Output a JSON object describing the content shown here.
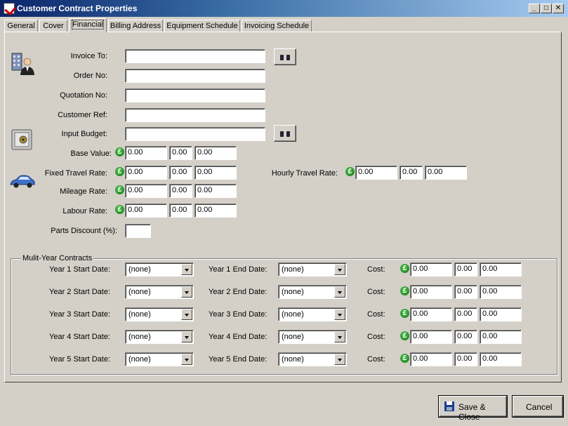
{
  "window": {
    "title": "Customer Contract Properties",
    "minimize": "_",
    "maximize": "□",
    "close": "✕"
  },
  "tabs": [
    {
      "label": "General"
    },
    {
      "label": "Cover"
    },
    {
      "label": "Financial"
    },
    {
      "label": "Billing Address"
    },
    {
      "label": "Equipment Schedule"
    },
    {
      "label": "Invoicing Schedule"
    }
  ],
  "active_tab": "Financial",
  "currency_symbol": "£",
  "fields": {
    "invoice_to": {
      "label": "Invoice To:",
      "value": ""
    },
    "order_no": {
      "label": "Order No:",
      "value": ""
    },
    "quotation_no": {
      "label": "Quotation No:",
      "value": ""
    },
    "customer_ref": {
      "label": "Customer Ref:",
      "value": ""
    },
    "input_budget": {
      "label": "Input Budget:",
      "value": ""
    },
    "parts_discount": {
      "label": "Parts Discount (%):",
      "value": ""
    }
  },
  "rates": {
    "base_value": {
      "label": "Base Value:",
      "values": [
        "0.00",
        "0.00",
        "0.00"
      ]
    },
    "fixed_travel_rate": {
      "label": "Fixed Travel Rate:",
      "values": [
        "0.00",
        "0.00",
        "0.00"
      ]
    },
    "hourly_travel_rate": {
      "label": "Hourly Travel Rate:",
      "values": [
        "0.00",
        "0.00",
        "0.00"
      ]
    },
    "mileage_rate": {
      "label": "Mileage Rate:",
      "values": [
        "0.00",
        "0.00",
        "0.00"
      ]
    },
    "labour_rate": {
      "label": "Labour Rate:",
      "values": [
        "0.00",
        "0.00",
        "0.00"
      ]
    }
  },
  "multi_year": {
    "title": "Mulit-Year Contracts",
    "cost_label": "Cost:",
    "years": [
      {
        "start_label": "Year 1 Start Date:",
        "start_value": "(none)",
        "end_label": "Year 1 End Date:",
        "end_value": "(none)",
        "cost": [
          "0.00",
          "0.00",
          "0.00"
        ]
      },
      {
        "start_label": "Year 2 Start Date:",
        "start_value": "(none)",
        "end_label": "Year 2 End Date:",
        "end_value": "(none)",
        "cost": [
          "0.00",
          "0.00",
          "0.00"
        ]
      },
      {
        "start_label": "Year 3 Start Date:",
        "start_value": "(none)",
        "end_label": "Year 3 End Date:",
        "end_value": "(none)",
        "cost": [
          "0.00",
          "0.00",
          "0.00"
        ]
      },
      {
        "start_label": "Year 4 Start Date:",
        "start_value": "(none)",
        "end_label": "Year 4 End Date:",
        "end_value": "(none)",
        "cost": [
          "0.00",
          "0.00",
          "0.00"
        ]
      },
      {
        "start_label": "Year 5 Start Date:",
        "start_value": "(none)",
        "end_label": "Year 5 End Date:",
        "end_value": "(none)",
        "cost": [
          "0.00",
          "0.00",
          "0.00"
        ]
      }
    ]
  },
  "buttons": {
    "save_close": "Save & Close",
    "cancel": "Cancel"
  },
  "icons": {
    "lookup": "binoculars-icon",
    "customer": "building-person-icon",
    "budget": "safe-icon",
    "travel": "car-icon",
    "save": "floppy-disk-icon"
  }
}
